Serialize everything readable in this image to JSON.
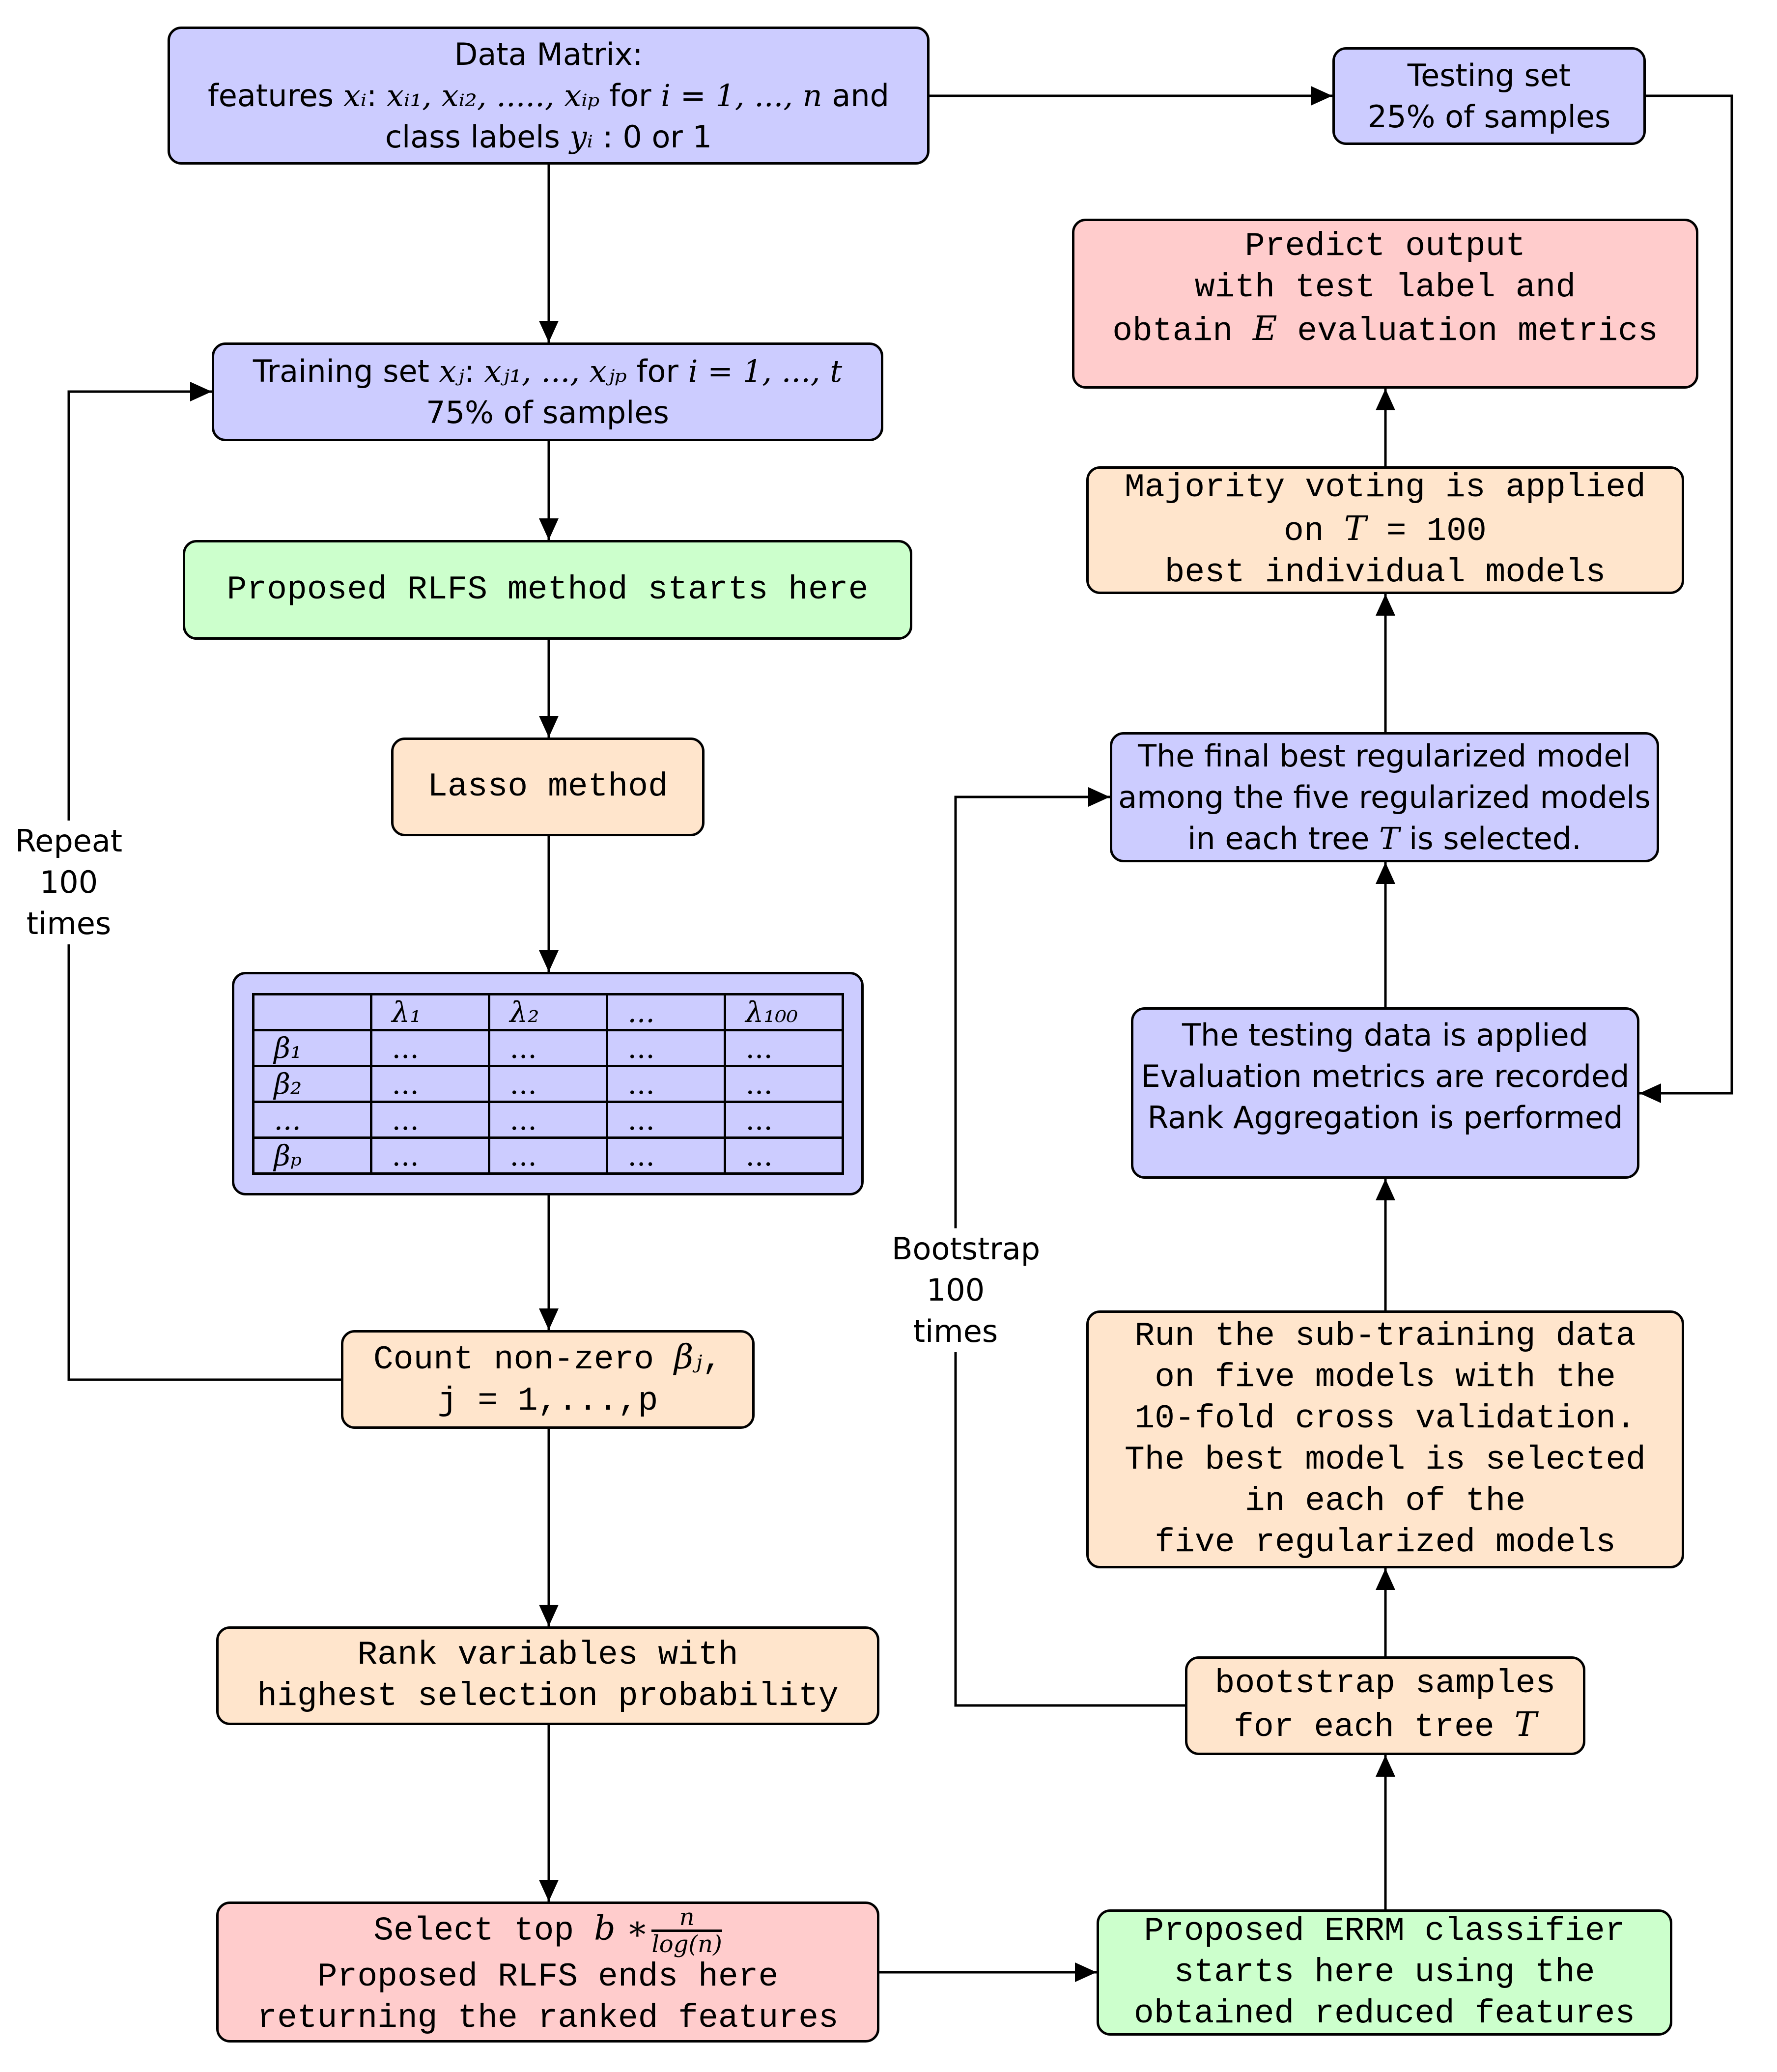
{
  "colors": {
    "blue": "#ccccff",
    "orange": "#ffe5cc",
    "green": "#ccffcc",
    "red": "#ffcccc",
    "stroke": "#000000"
  },
  "nodes": {
    "data_matrix": {
      "line1": "Data Matrix:",
      "line2_prefix": "features ",
      "line2_math1": "xᵢ",
      "line2_mid": ": ",
      "line2_math2": "xᵢ₁, xᵢ₂, ....., xᵢₚ",
      "line2_for": " for ",
      "line2_math3": "i = 1, ..., n",
      "line2_suffix": " and",
      "line3_prefix": "class labels ",
      "line3_math": "yᵢ",
      "line3_suffix": " : 0 or 1"
    },
    "testing_set": {
      "line1": "Testing set",
      "line2": "25% of samples"
    },
    "training_set": {
      "line1_prefix": "Training set ",
      "line1_math1": "xⱼ",
      "line1_mid": ": ",
      "line1_math2": "xⱼ₁, ..., xⱼₚ",
      "line1_for": " for ",
      "line1_math3": "i = 1, ..., t",
      "line2": "75% of samples"
    },
    "rlfs_start": {
      "text": "Proposed RLFS method starts here"
    },
    "lasso": {
      "text": "Lasso method"
    },
    "coef_table": {
      "header": [
        "",
        "λ₁",
        "λ₂",
        "...",
        "λ₁₀₀"
      ],
      "rows": [
        [
          "β₁",
          "...",
          "...",
          "...",
          "..."
        ],
        [
          "β₂",
          "...",
          "...",
          "...",
          "..."
        ],
        [
          "...",
          "...",
          "...",
          "...",
          "..."
        ],
        [
          "βₚ",
          "...",
          "...",
          "...",
          "..."
        ]
      ]
    },
    "count_nonzero": {
      "line1_prefix": "Count non-zero ",
      "line1_math": "βⱼ",
      "line1_suffix": ",",
      "line2": "j = 1,...,p"
    },
    "rank_vars": {
      "line1": "Rank variables with",
      "line2": "highest selection probability"
    },
    "select_top": {
      "line1_prefix": "Select top ",
      "line1_math": "b ∗",
      "frac_num": "n",
      "frac_den": "log(n)",
      "line2": "Proposed RLFS ends here",
      "line3": "returning the ranked features"
    },
    "errm_start": {
      "line1": "Proposed ERRM classifier",
      "line2": "starts here using the",
      "line3": "obtained reduced features"
    },
    "bootstrap_samples": {
      "line1": "bootstrap samples",
      "line2_prefix": "for each tree ",
      "line2_math": "T"
    },
    "run_subtraining": {
      "lines": [
        "Run the sub-training data",
        "on five models with the",
        "10-fold cross validation.",
        "The best model is selected",
        "in each of the",
        "five regularized models"
      ]
    },
    "testing_data": {
      "lines": [
        "The testing data is applied",
        "Evaluation metrics are recorded",
        "Rank Aggregation is performed"
      ]
    },
    "final_best": {
      "line1": "The final best regularized model",
      "line2": "among the five regularized models",
      "line3_prefix": "in each tree ",
      "line3_math": "T",
      "line3_suffix": " is selected."
    },
    "majority_voting": {
      "line1": "Majority voting is applied",
      "line2_prefix": "on ",
      "line2_math": "T",
      "line2_suffix": " = 100",
      "line3": "best individual models"
    },
    "predict_output": {
      "line1": "Predict output",
      "line2": "with test label and",
      "line3_prefix": "obtain ",
      "line3_math": "E",
      "line3_suffix": " evaluation metrics"
    }
  },
  "loop_labels": {
    "repeat": [
      "Repeat",
      "100",
      "times"
    ],
    "bootstrap": [
      "Bootstrap",
      "100",
      "times"
    ]
  }
}
